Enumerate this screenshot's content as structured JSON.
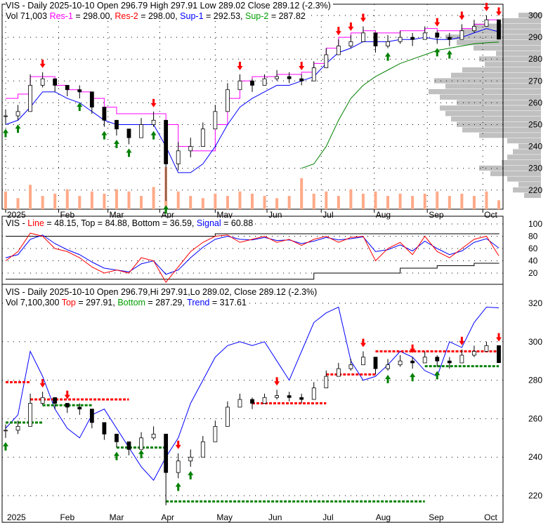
{
  "top_panel": {
    "line1": "VIS - Daily 2025-10-10 Open 296.79  High 297.91  Low 289.02  Close 289.12 (-2.3%)",
    "vol": "Vol 71,003",
    "res1_label": "Res-1",
    "res1_value": "= 298.00,",
    "res2_label": "Res-2",
    "res2_value": "= 298.00,",
    "sup1_label": "Sup-1",
    "sup1_value": "= 292.53,",
    "sup2_label": "Sup-2",
    "sup2_value": "= 287.82"
  },
  "mid_panel": {
    "prefix": "VIS -",
    "line_label": "Line",
    "line_value": "= 48.15, Top = 84.88, Bottom = 36.59,",
    "signal_label": "Signal",
    "signal_value": "= 60.88"
  },
  "bottom_panel": {
    "line1": "VIS - Daily 2025-10-10 Open 296.79,Hi 297.91,Lo 289.02, Close 289.12 (-2.3%)",
    "vol": "Vol 7,100,300",
    "top_label": "Top",
    "top_value": "= 297.91,",
    "bottom_label": "Bottom",
    "bottom_value": "= 287.29,",
    "trend_label": "Trend",
    "trend_value": "= 317.61"
  },
  "colors": {
    "up_arrow": "#008000",
    "down_arrow": "#ff0000",
    "res1": "#ff00ff",
    "sup1": "#0000ff",
    "sup2": "#008000",
    "volume": "#ffaa88",
    "profile": "#c0c0c0"
  },
  "chart_data": {
    "type": "line",
    "ticker": "VIS",
    "x_tick_labels": [
      {
        "label": "2025",
        "i": 0
      },
      {
        "label": "Feb",
        "i": 4.3
      },
      {
        "label": "Mar",
        "i": 8.3
      },
      {
        "label": "Apr",
        "i": 12.5
      },
      {
        "label": "May",
        "i": 17
      },
      {
        "label": "Jun",
        "i": 21.2
      },
      {
        "label": "Jul",
        "i": 25.6
      },
      {
        "label": "Aug",
        "i": 29.9
      },
      {
        "label": "Sep",
        "i": 34.2
      },
      {
        "label": "Oct",
        "i": 38.7
      }
    ],
    "close": [
      254,
      256,
      268,
      271,
      268,
      266,
      265,
      258,
      252,
      248,
      244,
      250,
      252,
      232,
      238,
      240,
      248,
      256,
      266,
      270,
      268,
      271,
      272,
      271,
      270,
      276,
      282,
      286,
      288,
      292,
      286,
      288,
      290,
      289,
      292,
      290,
      289,
      293,
      295,
      298,
      289.12
    ],
    "high": [
      257,
      259,
      273,
      274,
      271,
      268,
      268,
      262,
      256,
      252,
      248,
      253,
      256,
      248,
      242,
      244,
      251,
      259,
      269,
      273,
      271,
      273,
      275,
      274,
      273,
      279,
      285,
      289,
      291,
      295,
      290,
      291,
      293,
      292,
      295,
      293,
      292,
      296,
      298,
      300,
      297.91
    ],
    "low": [
      250,
      252,
      256,
      267,
      265,
      263,
      262,
      255,
      249,
      245,
      241,
      246,
      249,
      215,
      229,
      235,
      244,
      252,
      262,
      266,
      265,
      268,
      270,
      269,
      268,
      272,
      278,
      282,
      285,
      288,
      283,
      285,
      287,
      286,
      289,
      287,
      286,
      290,
      292,
      295,
      289.02
    ],
    "volume": [
      40,
      25,
      55,
      30,
      35,
      45,
      30,
      40,
      35,
      45,
      40,
      30,
      50,
      95,
      40,
      30,
      25,
      35,
      30,
      40,
      35,
      30,
      25,
      30,
      70,
      35,
      40,
      30,
      45,
      35,
      40,
      30,
      35,
      30,
      35,
      40,
      30,
      35,
      30,
      40,
      20
    ],
    "res1": [
      262,
      264,
      272,
      272,
      268,
      266,
      265,
      262,
      258,
      255,
      255,
      255,
      255,
      250,
      240,
      238,
      238,
      250,
      262,
      270,
      272,
      272,
      273,
      273,
      274,
      278,
      285,
      290,
      292,
      293,
      292,
      292,
      293,
      293,
      294,
      293,
      293,
      294,
      296,
      298,
      298
    ],
    "sup1": [
      250,
      252,
      258,
      265,
      265,
      262,
      260,
      256,
      252,
      250,
      250,
      250,
      250,
      240,
      228,
      228,
      232,
      240,
      250,
      258,
      262,
      265,
      268,
      268,
      270,
      272,
      278,
      283,
      285,
      288,
      288,
      288,
      289,
      289,
      290,
      289,
      289,
      290,
      292,
      294,
      292.53
    ],
    "sup2": [
      null,
      null,
      null,
      null,
      null,
      null,
      null,
      null,
      null,
      null,
      null,
      null,
      null,
      null,
      null,
      null,
      null,
      null,
      null,
      null,
      null,
      null,
      null,
      null,
      230,
      232,
      240,
      252,
      262,
      268,
      272,
      275,
      278,
      280,
      282,
      284,
      285,
      286,
      287,
      287.5,
      287.82
    ],
    "arrows_top": [
      {
        "i": 3,
        "t": "down"
      },
      {
        "i": 12,
        "t": "down"
      },
      {
        "i": 19,
        "t": "down"
      },
      {
        "i": 24,
        "t": "down"
      },
      {
        "i": 27,
        "t": "down"
      },
      {
        "i": 28,
        "t": "down"
      },
      {
        "i": 29,
        "t": "down"
      },
      {
        "i": 35,
        "t": "down"
      },
      {
        "i": 37,
        "t": "down"
      },
      {
        "i": 39,
        "t": "down"
      },
      {
        "i": 40,
        "t": "down"
      },
      {
        "i": 0,
        "t": "up"
      },
      {
        "i": 1,
        "t": "up"
      },
      {
        "i": 6,
        "t": "up"
      },
      {
        "i": 8,
        "t": "up"
      },
      {
        "i": 9,
        "t": "up"
      },
      {
        "i": 10,
        "t": "up"
      },
      {
        "i": 12,
        "t": "up"
      },
      {
        "i": 13,
        "t": "up"
      },
      {
        "i": 31,
        "t": "up"
      },
      {
        "i": 35,
        "t": "up"
      },
      {
        "i": 36,
        "t": "up"
      }
    ],
    "profile_levels": [
      217.5,
      220,
      222.5,
      225,
      227.5,
      230,
      232.5,
      235,
      237.5,
      240,
      242.5,
      245,
      247.5,
      250,
      252.5,
      255,
      257.5,
      260,
      262.5,
      265,
      267.5,
      270,
      272.5,
      275,
      277.5,
      280,
      282.5,
      285,
      287.5,
      290,
      292.5,
      295,
      297.5,
      300
    ],
    "profile_volume": [
      0.15,
      0.25,
      0.2,
      0.3,
      0.45,
      0.55,
      0.35,
      0.3,
      0.25,
      0.2,
      0.3,
      0.55,
      0.7,
      0.75,
      0.8,
      0.85,
      0.9,
      0.75,
      0.9,
      1.0,
      0.85,
      0.95,
      0.8,
      0.7,
      0.5,
      0.55,
      0.4,
      0.6,
      0.75,
      0.85,
      0.7,
      0.6,
      0.35,
      0.2
    ],
    "osc_line": [
      40,
      55,
      85,
      80,
      60,
      55,
      45,
      30,
      20,
      25,
      20,
      45,
      40,
      5,
      30,
      55,
      70,
      80,
      82,
      70,
      75,
      80,
      70,
      75,
      65,
      75,
      80,
      70,
      78,
      80,
      40,
      60,
      70,
      50,
      80,
      55,
      45,
      60,
      75,
      80,
      48.15
    ],
    "osc_signal": [
      45,
      50,
      75,
      82,
      68,
      58,
      50,
      38,
      28,
      25,
      22,
      35,
      40,
      18,
      25,
      45,
      62,
      75,
      80,
      75,
      74,
      78,
      73,
      74,
      68,
      72,
      78,
      74,
      76,
      79,
      55,
      58,
      66,
      56,
      72,
      60,
      50,
      56,
      70,
      76,
      60.88
    ],
    "osc_top": [
      80,
      80,
      80,
      80,
      80,
      80,
      80,
      80,
      80,
      80,
      80,
      80,
      80,
      80,
      80,
      80,
      80,
      84,
      84,
      84,
      84,
      84,
      84,
      84,
      84,
      84,
      84,
      84,
      84,
      84,
      84,
      84,
      84,
      84,
      84,
      84,
      84,
      84,
      84,
      84,
      84.88
    ],
    "osc_bottom": [
      10,
      10,
      10,
      10,
      10,
      10,
      10,
      10,
      10,
      10,
      10,
      10,
      10,
      10,
      10,
      10,
      10,
      10,
      10,
      10,
      10,
      10,
      10,
      10,
      10,
      20,
      20,
      20,
      20,
      20,
      20,
      20,
      28,
      28,
      28,
      32,
      32,
      32,
      36,
      36,
      36.59
    ],
    "trend": [
      255,
      262,
      295,
      282,
      265,
      255,
      250,
      262,
      265,
      255,
      245,
      235,
      228,
      240,
      250,
      268,
      280,
      292,
      298,
      300,
      298,
      300,
      290,
      280,
      295,
      310,
      315,
      318,
      290,
      280,
      282,
      288,
      295,
      292,
      285,
      282,
      300,
      297,
      310,
      318,
      317.61
    ],
    "top_levels": [
      {
        "from": 0,
        "to": 2,
        "v": 279
      },
      {
        "from": 2,
        "to": 10,
        "v": 270
      },
      {
        "from": 20,
        "to": 26,
        "v": 268
      },
      {
        "from": 26,
        "to": 30,
        "v": 283
      },
      {
        "from": 30,
        "to": 40,
        "v": 295
      }
    ],
    "bottom_levels": [
      {
        "from": 0,
        "to": 3,
        "v": 258
      },
      {
        "from": 3,
        "to": 7,
        "v": 267
      },
      {
        "from": 9,
        "to": 13,
        "v": 245
      },
      {
        "from": 13,
        "to": 34,
        "v": 217
      },
      {
        "from": 34,
        "to": 40,
        "v": 287.29
      }
    ],
    "arrows_bottom": [
      {
        "i": 3,
        "t": "down"
      },
      {
        "i": 5,
        "t": "down"
      },
      {
        "i": 14,
        "t": "down"
      },
      {
        "i": 22,
        "t": "down"
      },
      {
        "i": 29,
        "t": "down"
      },
      {
        "i": 33,
        "t": "down"
      },
      {
        "i": 37,
        "t": "down"
      },
      {
        "i": 40,
        "t": "down"
      },
      {
        "i": 0,
        "t": "up"
      },
      {
        "i": 9,
        "t": "up"
      },
      {
        "i": 11,
        "t": "up"
      },
      {
        "i": 14,
        "t": "up"
      },
      {
        "i": 15,
        "t": "up"
      },
      {
        "i": 31,
        "t": "up"
      },
      {
        "i": 33,
        "t": "up"
      },
      {
        "i": 35,
        "t": "up"
      }
    ],
    "top_axis": {
      "ylim": [
        220,
        300
      ],
      "ticks": [
        220,
        230,
        240,
        250,
        260,
        270,
        280,
        290,
        300
      ]
    },
    "mid_axis": {
      "ylim": [
        20,
        100
      ],
      "ticks": [
        20,
        40,
        60,
        80,
        100
      ]
    },
    "bottom_axis": {
      "ylim": [
        220,
        320
      ],
      "ticks": [
        220,
        240,
        260,
        280,
        300,
        320
      ]
    }
  }
}
